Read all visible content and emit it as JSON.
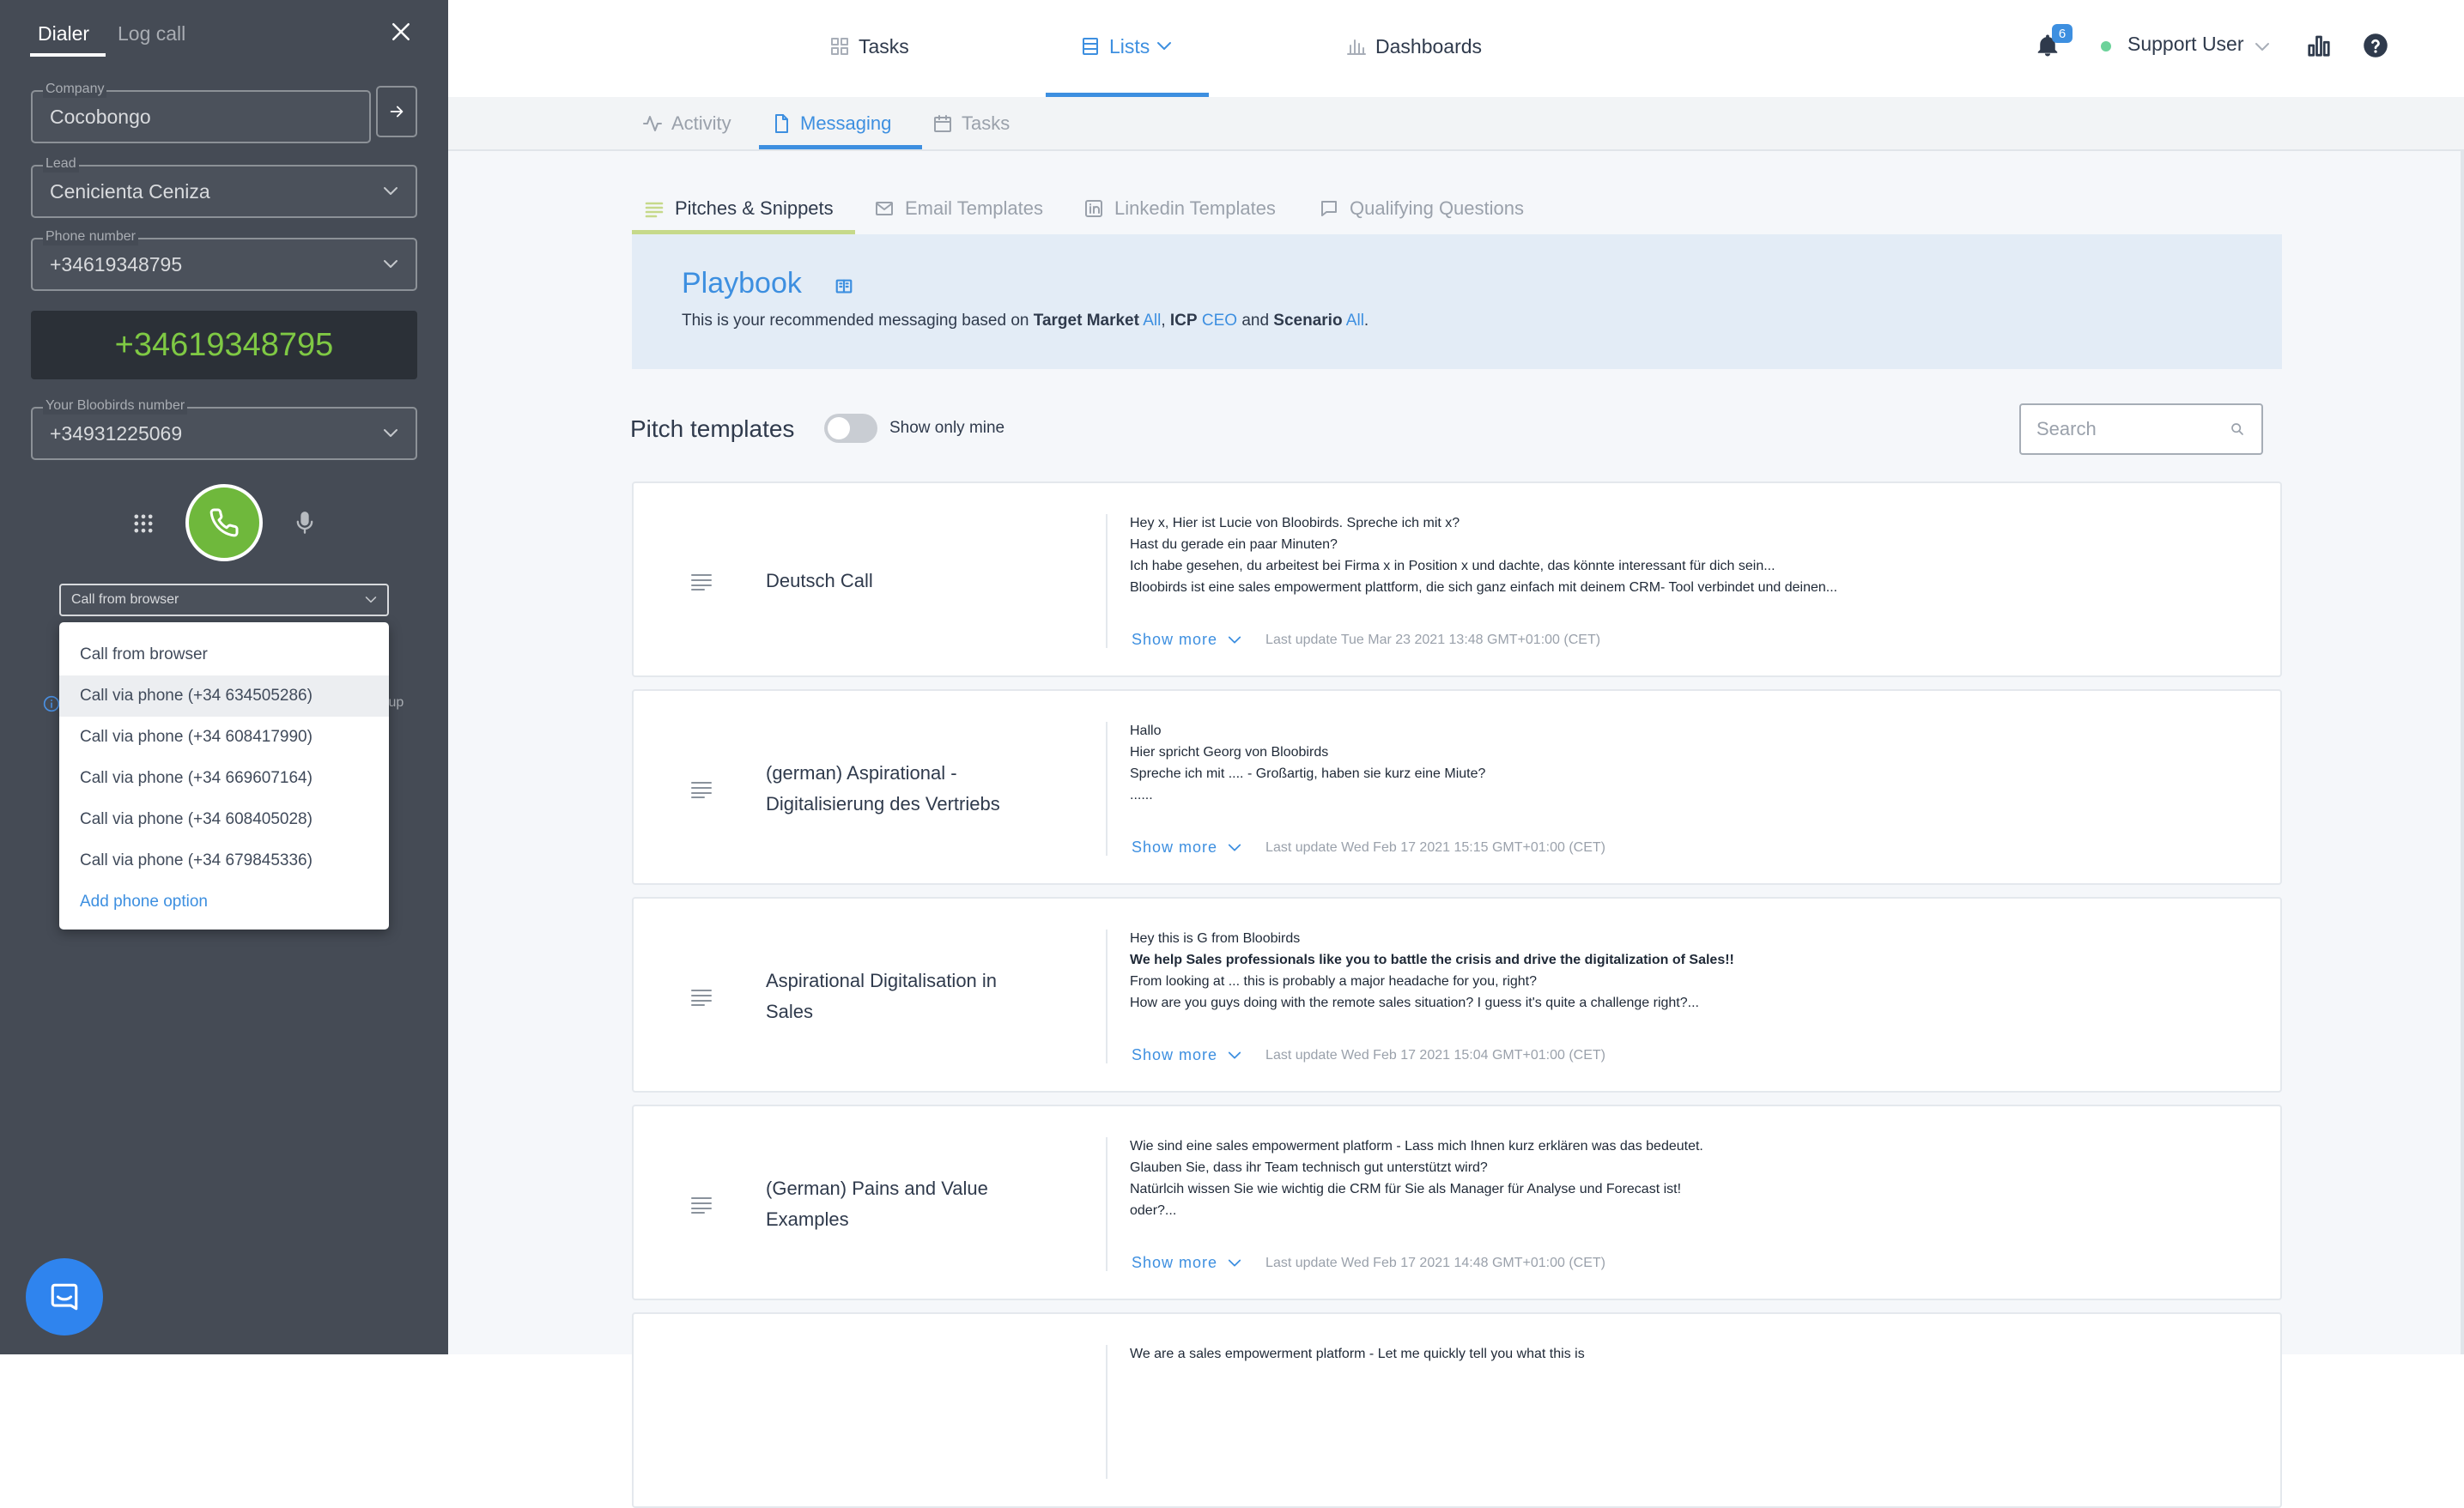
{
  "dialer": {
    "tabs": [
      "Dialer",
      "Log call"
    ],
    "company": {
      "label": "Company",
      "value": "Cocobongo"
    },
    "lead": {
      "label": "Lead",
      "value": "Cenicienta Ceniza"
    },
    "phone": {
      "label": "Phone number",
      "value": "+34619348795"
    },
    "display_number": "+34619348795",
    "bloobirds": {
      "label": "Your Bloobirds number",
      "value": "+34931225069"
    },
    "call_mode": "Call from browser",
    "options": [
      "Call from browser",
      "Call via phone (+34 634505286)",
      "Call via phone (+34 608417990)",
      "Call via phone (+34 669607164)",
      "Call via phone (+34 608405028)",
      "Call via phone (+34 679845336)"
    ],
    "add_option": "Add phone option",
    "setup_hint_fragment": "tup"
  },
  "nav": {
    "tasks": "Tasks",
    "lists": "Lists",
    "dashboards": "Dashboards",
    "notifications": "6",
    "user": "Support User"
  },
  "subnav": {
    "activity": "Activity",
    "messaging": "Messaging",
    "tasks": "Tasks"
  },
  "content_tabs": {
    "pitches": "Pitches & Snippets",
    "email": "Email Templates",
    "linkedin": "Linkedin Templates",
    "qualifying": "Qualifying Questions"
  },
  "playbook": {
    "title": "Playbook",
    "desc_prefix": "This is your recommended messaging based on",
    "target_market_label": "Target Market",
    "target_market": "All",
    "icp_label": "ICP",
    "icp": "CEO",
    "and": "and",
    "scenario_label": "Scenario",
    "scenario": "All"
  },
  "pitch_templates": {
    "title": "Pitch templates",
    "toggle_label": "Show only mine",
    "search_placeholder": "Search",
    "show_more": "Show more",
    "cards": [
      {
        "title": "Deutsch Call",
        "lines": [
          "Hey x,  Hier ist Lucie von Bloobirds. Spreche ich mit x?",
          "Hast du gerade ein paar Minuten?",
          "Ich habe gesehen, du arbeitest bei Firma x in Position x und dachte, das könnte interessant für dich sein...",
          "Bloobirds ist eine sales empowerment plattform, die sich ganz einfach mit deinem CRM- Tool verbindet und deinen..."
        ],
        "updated": "Last update Tue Mar 23 2021 13:48 GMT+01:00 (CET)"
      },
      {
        "title": "(german) Aspirational - Digitalisierung des Vertriebs",
        "lines": [
          "Hallo",
          "Hier spricht Georg von Bloobirds",
          "Spreche ich mit .... - Großartig, haben sie kurz eine Miute?",
          "......"
        ],
        "updated": "Last update Wed Feb 17 2021 15:15 GMT+01:00 (CET)"
      },
      {
        "title": "Aspirational Digitalisation in Sales",
        "lines": [
          "Hey this is G from Bloobirds",
          "We help Sales professionals like you to battle the crisis and drive the digitalization of Sales!!",
          "From looking at ... this is probably a major headache for you, right?",
          "How are you guys doing with the remote sales situation? I guess it's quite a challenge right?..."
        ],
        "updated": "Last update Wed Feb 17 2021 15:04 GMT+01:00 (CET)"
      },
      {
        "title": "(German) Pains and Value Examples",
        "lines": [
          "Wie sind eine sales empowerment platform - Lass mich Ihnen kurz erklären was das bedeutet.",
          "Glauben Sie, dass ihr Team technisch gut unterstützt wird?",
          "Natürlcih wissen Sie wie wichtig die CRM für Sie als Manager für Analyse und Forecast ist!",
          "oder?..."
        ],
        "updated": "Last update Wed Feb 17 2021 14:48 GMT+01:00 (CET)"
      },
      {
        "title": "",
        "lines": [
          "We are a sales empowerment platform - Let me quickly tell you what this is"
        ],
        "updated": ""
      }
    ]
  },
  "colors": {
    "accent": "#3d8fe0",
    "call_green": "#6fb83c",
    "dialer_bg": "#454b55",
    "pitch_accent": "#c6d98a"
  }
}
